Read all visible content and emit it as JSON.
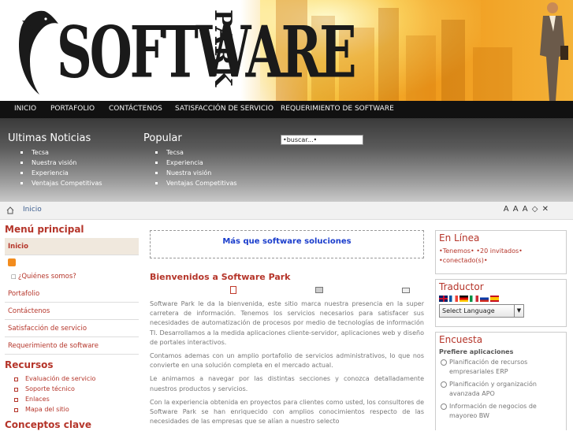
{
  "header": {
    "logo_word": "SOFTWARE",
    "logo_side": "PARK"
  },
  "nav": [
    {
      "label": "INICIO"
    },
    {
      "label": "PORTAFOLIO"
    },
    {
      "label": "CONTÁCTENOS"
    },
    {
      "label": "SATISFACCIÓN DE SERVICIO"
    },
    {
      "label": "REQUERIMIENTO DE SOFTWARE"
    }
  ],
  "news": {
    "title": "Ultimas Noticias",
    "items": [
      "Tecsa",
      "Nuestra visión",
      "Experiencia",
      "Ventajas Competitivas"
    ]
  },
  "popular": {
    "title": "Popular",
    "items": [
      "Tecsa",
      "Experiencia",
      "Nuestra visión",
      "Ventajas Competitivas"
    ]
  },
  "search": {
    "value": "•buscar...•"
  },
  "breadcrumb": {
    "home": "Inicio",
    "tools": "A A A ◇ ✕"
  },
  "main_menu": {
    "title": "Menú principal",
    "items": [
      "Inicio",
      "¿Quiénes somos?",
      "Portafolio",
      "Contáctenos",
      "Satisfacción de servicio",
      "Requerimiento de software"
    ]
  },
  "resources": {
    "title": "Recursos",
    "items": [
      "Evaluación de servicio",
      "Soporte técnico",
      "Enlaces",
      "Mapa del sitio"
    ]
  },
  "concepts": {
    "title": "Conceptos clave"
  },
  "content": {
    "promo": "Más que software soluciones",
    "heading": "Bienvenidos a Software Park",
    "paragraphs": [
      "Software Park le da la bienvenida, este sitio marca nuestra presencia en la super carretera de información. Tenemos los servicios necesarios para satisfacer sus necesidades de automatización de procesos por medio de tecnologías de información TI. Desarrollamos a la medida aplicaciones cliente-servidor, aplicaciones web y diseño de portales interactivos.",
      "Contamos ademas con un amplio portafolio de servicios administrativos, lo que nos convierte en una solución completa en el mercado actual.",
      "Le animamos a navegar por las distintas secciones y conozca detalladamente nuestros productos y servicios.",
      "Con la experiencia obtenida en proyectos para clientes como usted, los consultores de Software Park se han enriquecido con amplios conocimientos respecto de las necesidades de las empresas que se alían a nuestro selecto"
    ]
  },
  "online": {
    "title": "En Línea",
    "text": "•Tenemos• •20 invitados• •conectado(s)•"
  },
  "translator": {
    "title": "Traductor",
    "select": "Select Language"
  },
  "poll": {
    "title": "Encuesta",
    "question": "Prefiere aplicaciones",
    "options": [
      "Planificación de recursos empresariales ERP",
      "Planificación y organización avanzada APO",
      "Información de negocios de mayoreo BW"
    ]
  }
}
